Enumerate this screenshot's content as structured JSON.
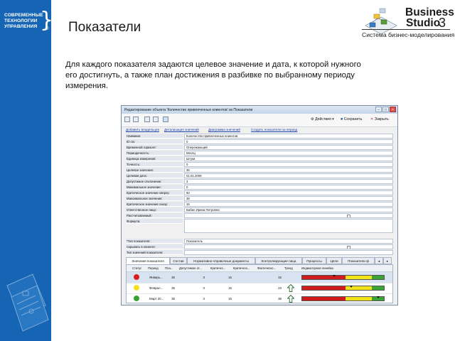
{
  "left_logo": {
    "lines": [
      "СОВРЕМЕННЫЕ",
      "ТЕХНОЛОГИИ",
      "УПРАВЛЕНИЯ"
    ]
  },
  "header": {
    "title": "Показатели",
    "brand_line1": "Business",
    "brand_line2": "Studio",
    "brand_version": "3",
    "brand_tagline": "Система бизнес-моделирования"
  },
  "description": "Для каждого показателя задаются целевое значение и дата, к которой нужного его достигнуть, а также план достижения в разбивке по выбранному периоду измерения.",
  "window": {
    "title": "Редактирование объекта 'Количество привлеченных клиентов' из Показатели",
    "toolbar": {
      "actions_label": "Действия",
      "save_label": "Сохранить",
      "close_label": "Закрыть"
    },
    "links": [
      "Добавить владельцев",
      "Детализация значений",
      "Диаграмма значений",
      "Создать показатели за период"
    ],
    "fields": [
      {
        "label": "Название:",
        "value": "Количество привлеченных клиентов"
      },
      {
        "label": "ID ctx:",
        "value": "0"
      },
      {
        "label": "Временной горизонт:",
        "value": "Опережающий"
      },
      {
        "label": "Периодичность:",
        "value": "Месяц"
      },
      {
        "label": "Единица измерения:",
        "value": "Штуки"
      },
      {
        "label": "Точность:",
        "value": "0"
      },
      {
        "label": "Целевое значение:",
        "value": "35"
      },
      {
        "label": "Целевая дата:",
        "value": "01.01.2009"
      },
      {
        "label": "Допустимое отклонение:",
        "value": "3"
      },
      {
        "label": "Минимальное значение:",
        "value": "0"
      },
      {
        "label": "Критическое значение сверху:",
        "value": "60"
      },
      {
        "label": "Максимальное значение:",
        "value": "38"
      },
      {
        "label": "Критическое значение снизу:",
        "value": "15"
      },
      {
        "label": "Ответственное лицо:",
        "value": "Бабин Ирина Петровна"
      },
      {
        "label": "Рассчитываемый:",
        "value": ""
      },
      {
        "label": "Формула:",
        "value": ""
      },
      {
        "label": "*Тип показателя:",
        "value": "Показатель"
      },
      {
        "label": "Скрывать в клиенте:",
        "value": ""
      },
      {
        "label": "Тип значений показателя:",
        "value": ""
      }
    ],
    "tabs": [
      "Значения показателя",
      "Состав",
      "Нормативно-справочные документы",
      "Контролирующие лица",
      "Процессы",
      "Цели",
      "Показатели ф"
    ],
    "grid": {
      "columns": [
        "Статус",
        "Период",
        "Пла...",
        "Допустимое от...",
        "Критичес...",
        "Критическ...",
        "Фактическо...",
        "Тренд",
        "Индикаторная линейка"
      ],
      "rows": [
        {
          "status_color": "#d81e1e",
          "period": "Январь...",
          "plan": "35",
          "tolerance": "3",
          "crit1": "15",
          "crit2": "",
          "actual": "15",
          "trend": "",
          "marker": 0.39
        },
        {
          "status_color": "#f4e21c",
          "period": "Феврал...",
          "plan": "35",
          "tolerance": "3",
          "crit1": "15",
          "crit2": "",
          "actual": "23",
          "trend": "up",
          "marker": 0.6
        },
        {
          "status_color": "#39a434",
          "period": "Март 20...",
          "plan": "35",
          "tolerance": "3",
          "crit1": "15",
          "crit2": "",
          "actual": "38",
          "trend": "up",
          "marker": 0.93
        }
      ]
    }
  }
}
